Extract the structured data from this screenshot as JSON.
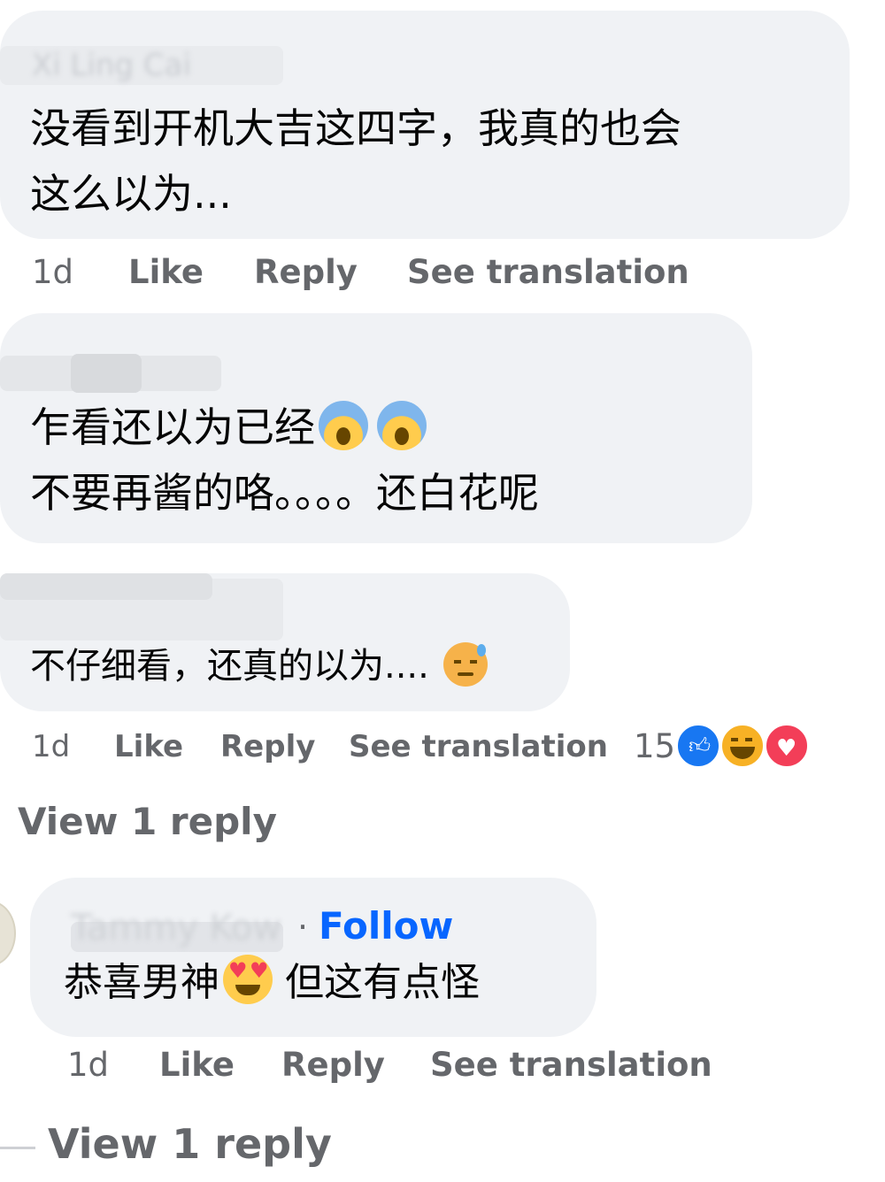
{
  "comments": [
    {
      "author": "Xi Ling Cai",
      "text_lines": [
        "没看到开机大吉这四字，我真的也会",
        "这么以为..."
      ],
      "meta": {
        "time": "1d",
        "like": "Like",
        "reply": "Reply",
        "translate": "See translation"
      }
    },
    {
      "author": "",
      "text_lines": [
        "乍看还以为已经",
        "不要再酱的咯。。。。还白花呢"
      ],
      "emojis": [
        "scream-emoji",
        "scream-emoji"
      ]
    },
    {
      "author": "",
      "text_lines": [
        "不仔细看，还真的以为...."
      ],
      "emojis": [
        "sweat-emoji"
      ],
      "meta": {
        "time": "1d",
        "like": "Like",
        "reply": "Reply",
        "translate": "See translation"
      },
      "reactions": {
        "count": "15",
        "types": [
          "like-icon",
          "haha-icon",
          "love-icon"
        ]
      },
      "view_replies": "View 1 reply"
    },
    {
      "author": "Tammy Kow",
      "separator": "·",
      "follow": "Follow",
      "text_lines": [
        "恭喜男神",
        "但这有点怪"
      ],
      "emojis": [
        "heart-eyes-emoji"
      ],
      "meta": {
        "time": "1d",
        "like": "Like",
        "reply": "Reply",
        "translate": "See translation"
      },
      "view_replies": "View 1 reply"
    }
  ],
  "colors": {
    "bubble": "#f0f2f5",
    "meta_text": "#65676b",
    "follow_blue": "#0866ff",
    "like_blue": "#1877f2",
    "love_red": "#f33e58",
    "haha_yellow": "#f7b125"
  }
}
